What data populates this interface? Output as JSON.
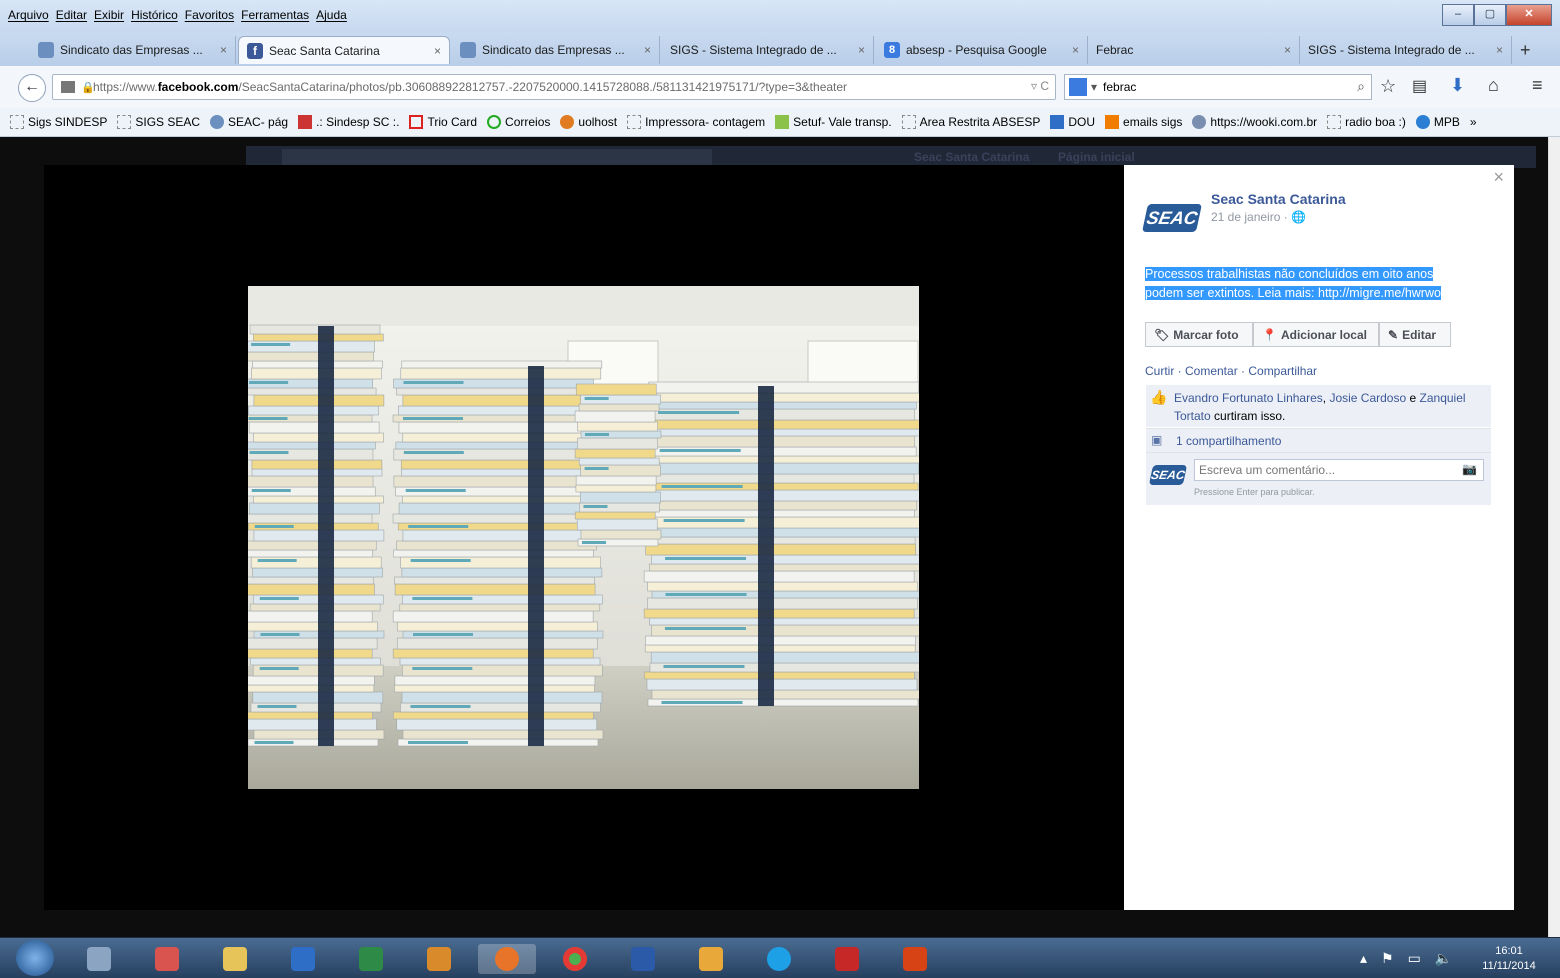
{
  "menu": [
    "Arquivo",
    "Editar",
    "Exibir",
    "Histórico",
    "Favoritos",
    "Ferramentas",
    "Ajuda"
  ],
  "window_controls": [
    "–",
    "▢",
    "✕"
  ],
  "tabs": [
    {
      "label": "Sindicato das Empresas ...",
      "color": "#6b8fbf"
    },
    {
      "label": "Seac Santa Catarina",
      "color": "#3b5998"
    },
    {
      "label": "Sindicato das Empresas ...",
      "color": "#6b8fbf"
    },
    {
      "label": "SIGS - Sistema Integrado de ...",
      "color": "#f5f8fc"
    },
    {
      "label": "absesp - Pesquisa Google",
      "color": "#3b7be0"
    },
    {
      "label": "Febrac",
      "color": "#f5f8fc"
    },
    {
      "label": "SIGS - Sistema Integrado de ...",
      "color": "#f5f8fc"
    }
  ],
  "new_tab": "+",
  "url": {
    "prefix": "https://www.",
    "domain": "facebook.com",
    "path": "/SeacSantaCatarina/photos/pb.306088922812757.-2207520000.1415728088./581131421975171/?type=3&theater"
  },
  "search": {
    "value": "febrac"
  },
  "bookmarks": [
    "Sigs SINDESP",
    "SIGS SEAC",
    "SEAC- pág",
    ".: Sindesp SC :.",
    "Trio Card",
    "Correios",
    "uolhost",
    "Impressora- contagem",
    "Setuf- Vale transp.",
    "Area Restrita ABSESP",
    "DOU",
    "emails sigs",
    "https://wooki.com.br",
    "radio boa :)",
    "MPB"
  ],
  "bookmarks_overflow": "»",
  "facebook_bar": {
    "page_name": "Seac Santa Catarina",
    "home": "Página inicial"
  },
  "post": {
    "close": "×",
    "logo": "SEAC",
    "page_name": "Seac Santa Catarina",
    "date": "21 de janeiro · ",
    "text_line1": "Processos trabalhistas não concluídos em oito anos",
    "text_line2": "podem ser extintos. Leia mais: http://migre.me/hwrwo",
    "buttons": [
      "Marcar foto",
      "Adicionar local",
      "Editar"
    ],
    "actions": "Curtir · Comentar · Compartilhar",
    "likes": {
      "names": [
        "Evandro Fortunato Linhares",
        "Josie Cardoso",
        "Zanquiel Tortato"
      ],
      "sep": ", ",
      "and": " e",
      "suffix": " curtiram isso."
    },
    "shares": "1 compartilhamento",
    "comment_placeholder": "Escreva um comentário...",
    "comment_hint": "Pressione Enter para publicar."
  },
  "taskbar": {
    "time": "16:01",
    "date": "11/11/2014"
  }
}
